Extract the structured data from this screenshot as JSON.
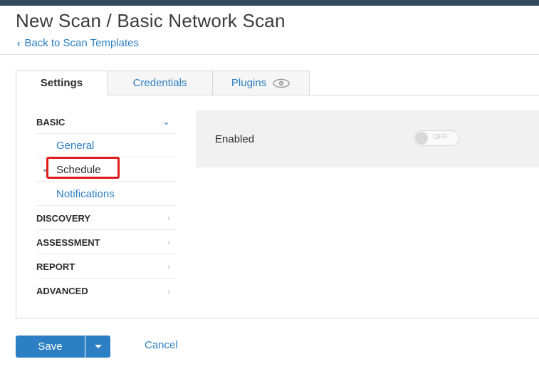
{
  "header": {
    "title": "New Scan / Basic Network Scan",
    "back_link": "Back to Scan Templates"
  },
  "tabs": [
    {
      "label": "Settings",
      "active": true
    },
    {
      "label": "Credentials",
      "active": false
    },
    {
      "label": "Plugins",
      "active": false,
      "icon": "eye-icon"
    }
  ],
  "sidebar": {
    "sections": [
      {
        "label": "BASIC",
        "expanded": true,
        "items": [
          "General",
          "Schedule",
          "Notifications"
        ],
        "selected": "Schedule"
      },
      {
        "label": "DISCOVERY",
        "expanded": false
      },
      {
        "label": "ASSESSMENT",
        "expanded": false
      },
      {
        "label": "REPORT",
        "expanded": false
      },
      {
        "label": "ADVANCED",
        "expanded": false
      }
    ]
  },
  "schedule": {
    "enabled_label": "Enabled",
    "toggle_state": "OFF"
  },
  "footer": {
    "save_label": "Save",
    "cancel_label": "Cancel"
  },
  "colors": {
    "accent": "#2b7fc2",
    "highlight": "#e01b1b",
    "topbar": "#34495e"
  }
}
